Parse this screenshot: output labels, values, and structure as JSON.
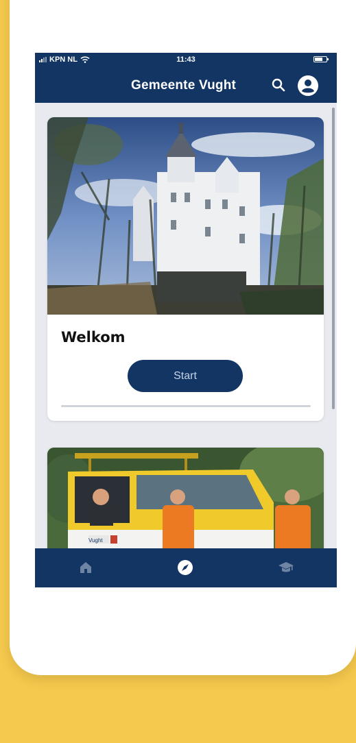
{
  "colors": {
    "background": "#f5c94d",
    "primary": "#123563",
    "screen": "#e8eaef",
    "button_text": "#c7d3e8"
  },
  "status_bar": {
    "carrier": "KPN NL",
    "time": "11:43",
    "icons": [
      "signal-icon",
      "wifi-icon",
      "battery-icon"
    ]
  },
  "app_bar": {
    "title": "Gemeente Vught",
    "icons": [
      "search-icon",
      "account-icon"
    ]
  },
  "cards": [
    {
      "image": "castle-photo",
      "title": "Welkom",
      "button_label": "Start",
      "progress": 0
    },
    {
      "image": "team-van-photo",
      "van_text": "Vught"
    }
  ],
  "tab_bar": {
    "items": [
      {
        "icon": "home-icon",
        "active": false
      },
      {
        "icon": "compass-icon",
        "active": true
      },
      {
        "icon": "graduation-cap-icon",
        "active": false
      }
    ]
  }
}
